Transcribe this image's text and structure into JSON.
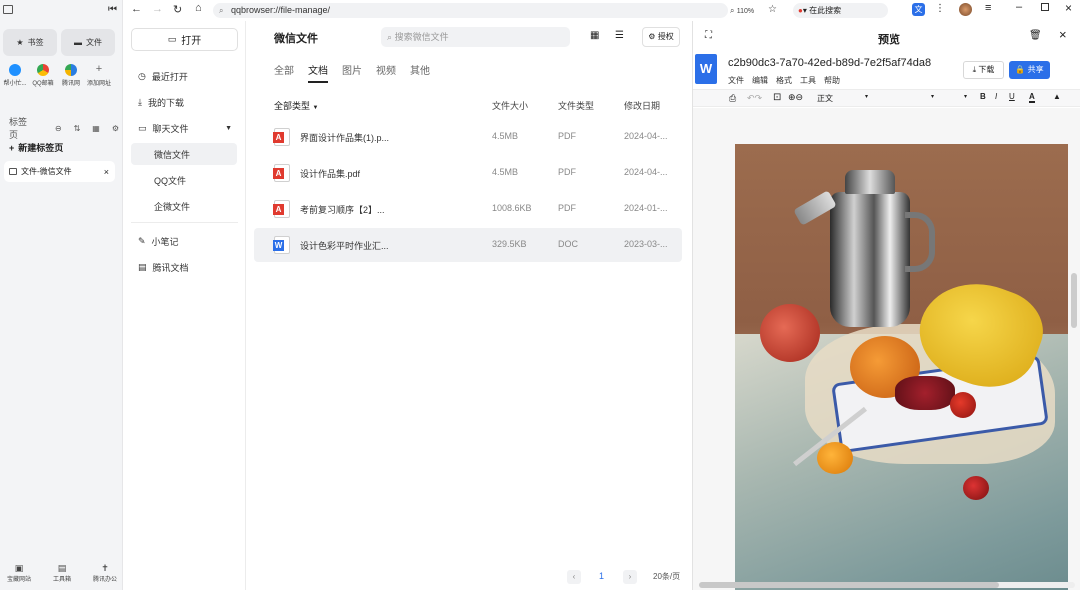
{
  "sidebar": {
    "bookmark_label": "书签",
    "file_label": "文件",
    "quick": [
      {
        "label": "帮小忙...",
        "color": "#1e90ff"
      },
      {
        "label": "QQ邮箱",
        "color": "#f4b400"
      },
      {
        "label": "腾讯网",
        "color": "#2a7de1"
      },
      {
        "label": "添加网址",
        "color": "#999999"
      }
    ],
    "tabs_label": "标签页",
    "new_tab": "新建标签页",
    "active_tab": "文件-微信文件",
    "bottom": [
      "宝藏网站",
      "工具箱",
      "腾讯办公"
    ]
  },
  "toolbar": {
    "address": "qqbrowser://file-manage/",
    "zoom": "110%",
    "search": "在此搜索"
  },
  "nav": {
    "open_button": "打开",
    "items": [
      "最近打开",
      "我的下载",
      "聊天文件"
    ],
    "chat_sub": [
      "微信文件",
      "QQ文件",
      "企微文件"
    ],
    "extra": [
      "小笔记",
      "腾讯文档"
    ]
  },
  "main": {
    "title": "微信文件",
    "search_placeholder": "搜索微信文件",
    "auth": "授权",
    "tabs": [
      "全部",
      "文档",
      "图片",
      "视频",
      "其他"
    ],
    "headers": {
      "type": "全部类型",
      "size": "文件大小",
      "kind": "文件类型",
      "date": "修改日期"
    },
    "rows": [
      {
        "name": "界面设计作品集(1).p...",
        "size": "4.5MB",
        "kind": "PDF",
        "date": "2024-04-..."
      },
      {
        "name": "设计作品集.pdf",
        "size": "4.5MB",
        "kind": "PDF",
        "date": "2024-04-..."
      },
      {
        "name": "考前复习顺序【2】...",
        "size": "1008.6KB",
        "kind": "PDF",
        "date": "2024-01-..."
      },
      {
        "name": "设计色彩平时作业汇...",
        "size": "329.5KB",
        "kind": "DOC",
        "date": "2023-03-..."
      }
    ],
    "page": "1",
    "per_page": "20条/页"
  },
  "preview": {
    "title": "预览",
    "doc_name": "c2b90dc3-7a70-42ed-b89d-7e2f5af74da8",
    "menu": [
      "文件",
      "编辑",
      "格式",
      "工具",
      "帮助"
    ],
    "download": "下载",
    "share": "共享",
    "style": "正文"
  },
  "colors": {
    "accent": "#2b6fe8",
    "pdf": "#e03a2f",
    "doc": "#2b6fe8"
  }
}
